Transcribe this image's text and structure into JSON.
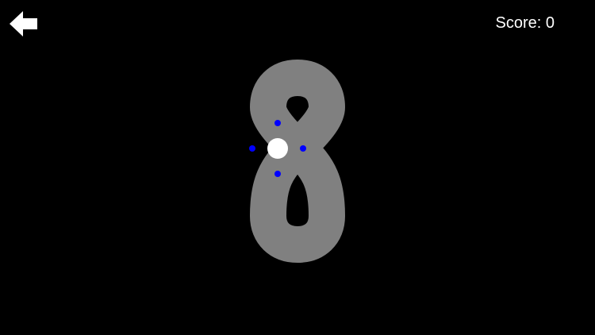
{
  "header": {
    "back_icon": "left-arrow-icon",
    "score_label": "Score:",
    "score_value": "0"
  },
  "track": {
    "shape": "figure-eight",
    "color": "#808080"
  },
  "player": {
    "color": "#ffffff"
  },
  "direction_markers": {
    "color": "#0000ff",
    "count": 4
  },
  "background_color": "#000000"
}
